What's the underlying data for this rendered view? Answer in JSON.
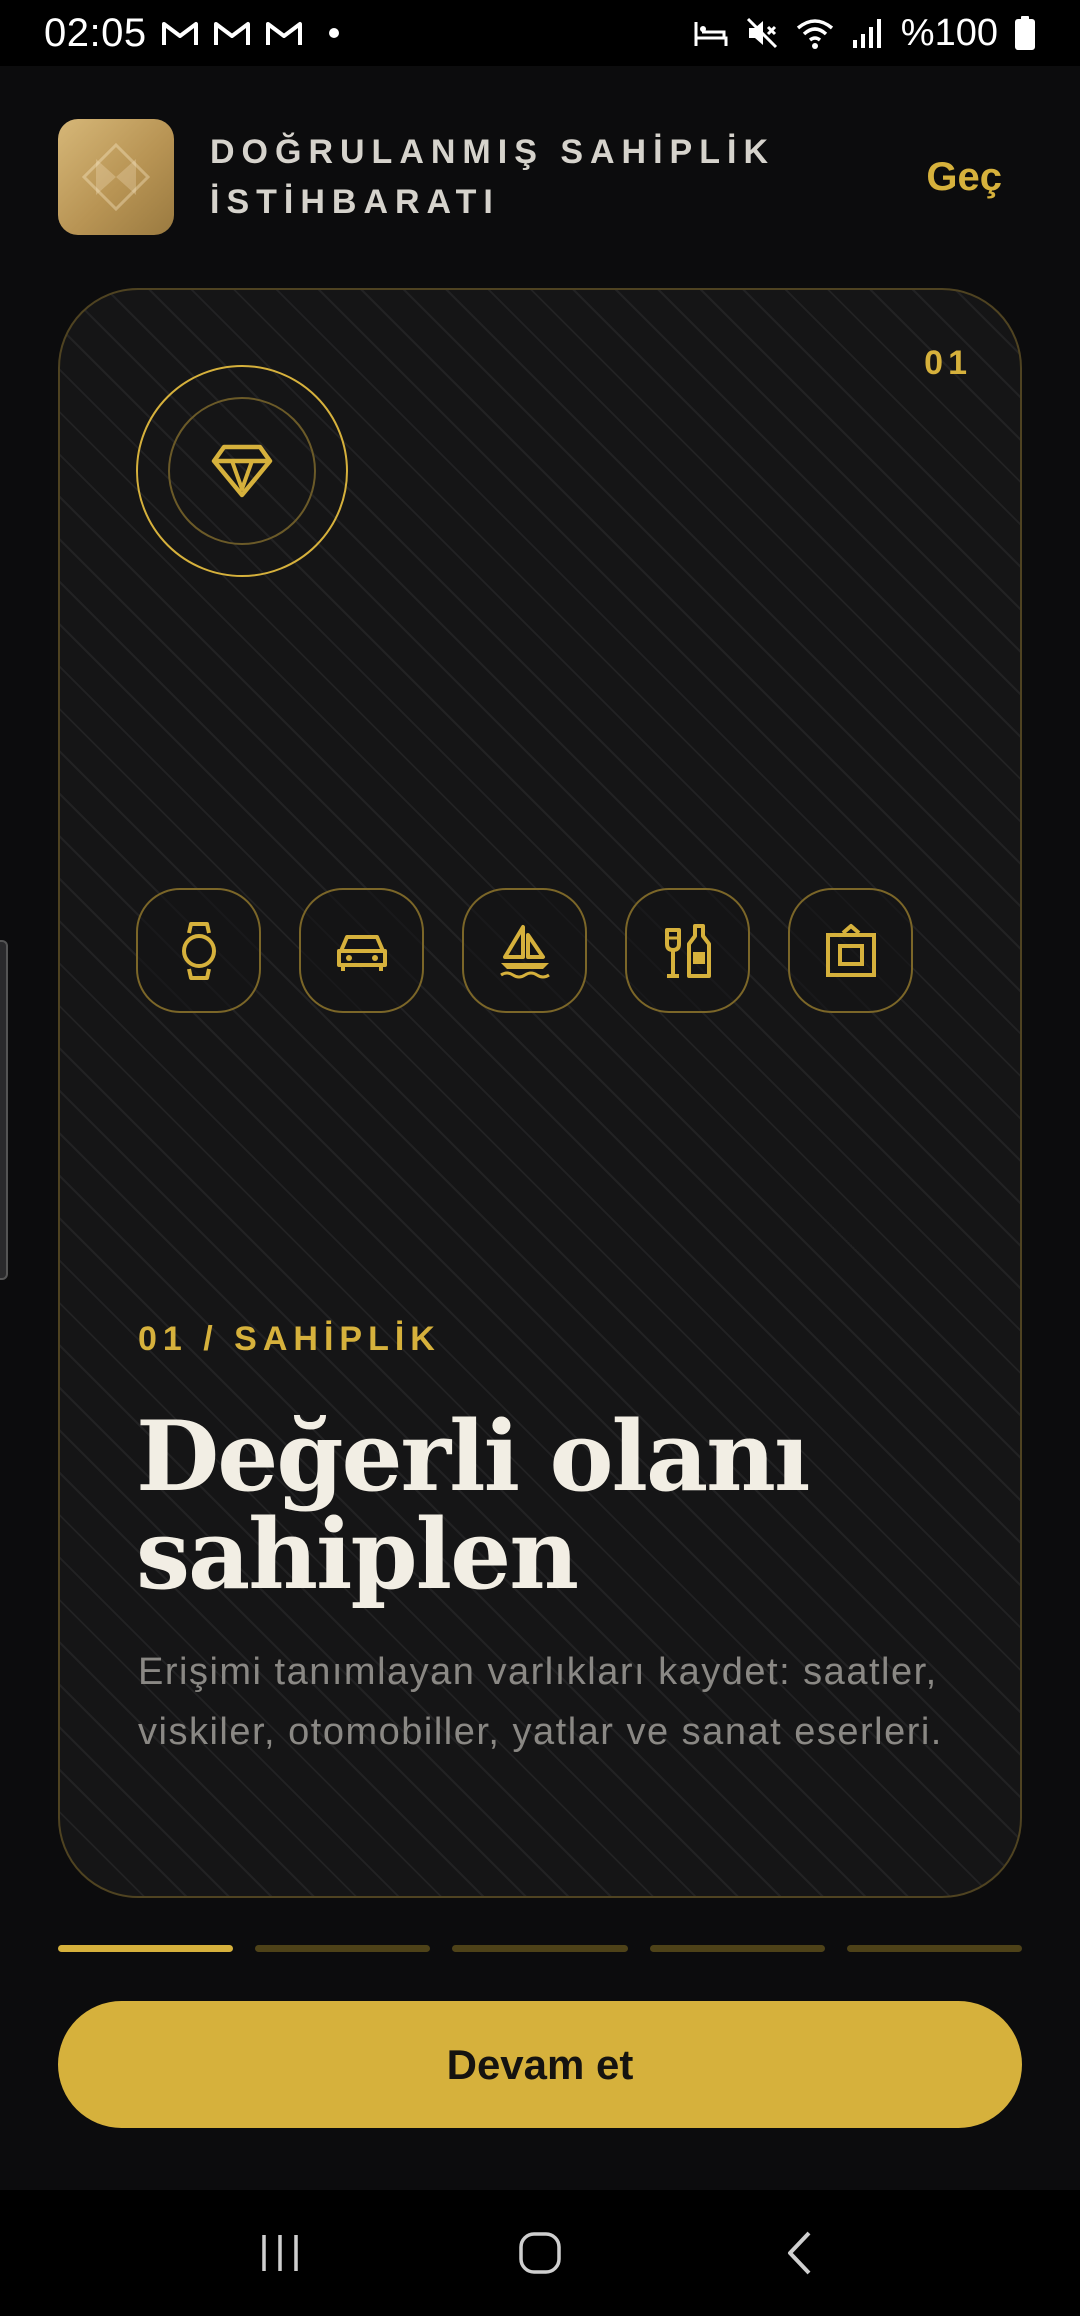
{
  "status_bar": {
    "time": "02:05",
    "battery_text": "%100",
    "icons": [
      "gmail-icon",
      "gmail-icon",
      "gmail-icon",
      "notification-dot",
      "alarm-bed-icon",
      "mute-icon",
      "wifi-icon",
      "signal-icon",
      "battery-icon"
    ]
  },
  "header": {
    "logo": "app-logo-icon",
    "title": "DOĞRULANMIŞ SAHİPLİK İSTİHBARATI",
    "skip_label": "Geç"
  },
  "card": {
    "number": "01",
    "main_icon": "diamond-icon",
    "categories": [
      {
        "icon": "watch-icon"
      },
      {
        "icon": "car-icon"
      },
      {
        "icon": "sailboat-icon"
      },
      {
        "icon": "bottles-icon"
      },
      {
        "icon": "artwork-frame-icon"
      }
    ],
    "eyebrow": "01 / SAHİPLİK",
    "headline": "Değerli olanı sahiplen",
    "description": "Erişimi tanımlayan varlıkları kaydet: saatler, viskiler, otomobiller, yatlar ve sanat eserleri."
  },
  "progress": {
    "current_step": 1,
    "total_steps": 5
  },
  "cta": {
    "label": "Devam et"
  },
  "colors": {
    "accent_gold": "#d6b13c",
    "background": "#0c0c0d",
    "card_background": "#151516"
  }
}
